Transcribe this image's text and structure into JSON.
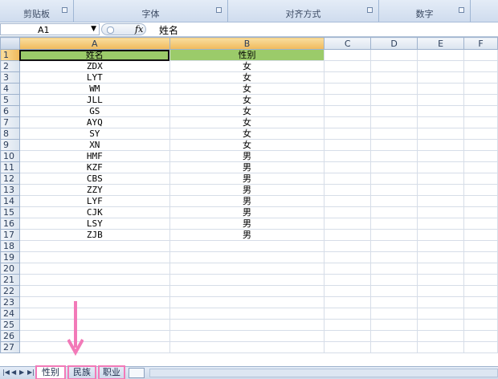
{
  "ribbon": {
    "groups": [
      {
        "label": "剪贴板"
      },
      {
        "label": "字体"
      },
      {
        "label": "对齐方式"
      },
      {
        "label": "数字"
      }
    ]
  },
  "formula_bar": {
    "name_box": "A1",
    "fx_label": "fx",
    "value": "姓名"
  },
  "columns": [
    "A",
    "B",
    "C",
    "D",
    "E",
    "F"
  ],
  "rows": [
    {
      "n": "1",
      "a": "姓名",
      "b": "性别"
    },
    {
      "n": "2",
      "a": "ZDX",
      "b": "女"
    },
    {
      "n": "3",
      "a": "LYT",
      "b": "女"
    },
    {
      "n": "4",
      "a": "WM",
      "b": "女"
    },
    {
      "n": "5",
      "a": "JLL",
      "b": "女"
    },
    {
      "n": "6",
      "a": "GS",
      "b": "女"
    },
    {
      "n": "7",
      "a": "AYQ",
      "b": "女"
    },
    {
      "n": "8",
      "a": "SY",
      "b": "女"
    },
    {
      "n": "9",
      "a": "XN",
      "b": "女"
    },
    {
      "n": "10",
      "a": "HMF",
      "b": "男"
    },
    {
      "n": "11",
      "a": "KZF",
      "b": "男"
    },
    {
      "n": "12",
      "a": "CBS",
      "b": "男"
    },
    {
      "n": "13",
      "a": "ZZY",
      "b": "男"
    },
    {
      "n": "14",
      "a": "LYF",
      "b": "男"
    },
    {
      "n": "15",
      "a": "CJK",
      "b": "男"
    },
    {
      "n": "16",
      "a": "LSY",
      "b": "男"
    },
    {
      "n": "17",
      "a": "ZJB",
      "b": "男"
    },
    {
      "n": "18",
      "a": "",
      "b": ""
    },
    {
      "n": "19",
      "a": "",
      "b": ""
    },
    {
      "n": "20",
      "a": "",
      "b": ""
    },
    {
      "n": "21",
      "a": "",
      "b": ""
    },
    {
      "n": "22",
      "a": "",
      "b": ""
    },
    {
      "n": "23",
      "a": "",
      "b": ""
    },
    {
      "n": "24",
      "a": "",
      "b": ""
    },
    {
      "n": "25",
      "a": "",
      "b": ""
    },
    {
      "n": "26",
      "a": "",
      "b": ""
    },
    {
      "n": "27",
      "a": "",
      "b": ""
    }
  ],
  "sheet_tabs": [
    {
      "label": "性别"
    },
    {
      "label": "民族"
    },
    {
      "label": "职业"
    }
  ],
  "colors": {
    "header_fill": "#9bcb6a",
    "highlight": "#f27ab8"
  }
}
